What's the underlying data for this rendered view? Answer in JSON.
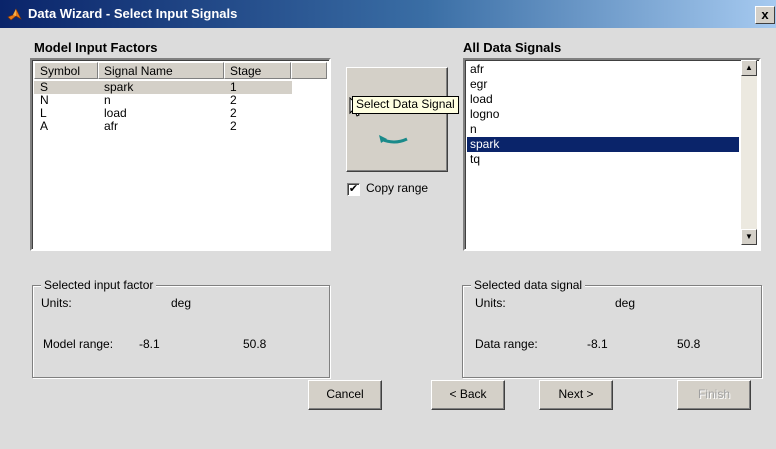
{
  "window": {
    "title": "Data Wizard - Select Input Signals",
    "close_label": "x"
  },
  "factors": {
    "heading": "Model Input Factors",
    "columns": [
      "Symbol",
      "Signal Name",
      "Stage"
    ],
    "rows": [
      {
        "symbol": "S",
        "signal": "spark",
        "stage": "1",
        "selected": true
      },
      {
        "symbol": "N",
        "signal": "n",
        "stage": "2",
        "selected": false
      },
      {
        "symbol": "L",
        "signal": "load",
        "stage": "2",
        "selected": false
      },
      {
        "symbol": "A",
        "signal": "afr",
        "stage": "2",
        "selected": false
      }
    ]
  },
  "select_signal": {
    "tooltip": "Select Data Signal",
    "icon": "swap-arrows-icon",
    "accent": "#1a8a8a"
  },
  "copy_range": {
    "label": "Copy range",
    "checked": true,
    "mark": "✔"
  },
  "signals": {
    "heading": "All Data Signals",
    "items": [
      "afr",
      "egr",
      "load",
      "logno",
      "n",
      "spark",
      "tq"
    ],
    "selected": "spark",
    "scroll_up": "▲",
    "scroll_down": "▼"
  },
  "input_factor": {
    "legend": "Selected input factor",
    "units_label": "Units:",
    "units_value": "deg",
    "range_label": "Model range:",
    "range_min": "-8.1",
    "range_max": "50.8"
  },
  "data_signal": {
    "legend": "Selected data signal",
    "units_label": "Units:",
    "units_value": "deg",
    "range_label": "Data range:",
    "range_min": "-8.1",
    "range_max": "50.8"
  },
  "buttons": {
    "cancel": "Cancel",
    "back": "< Back",
    "next": "Next >",
    "finish": "Finish"
  },
  "colors": {
    "title_bar": "#0a246a",
    "selection": "#0a246a"
  }
}
